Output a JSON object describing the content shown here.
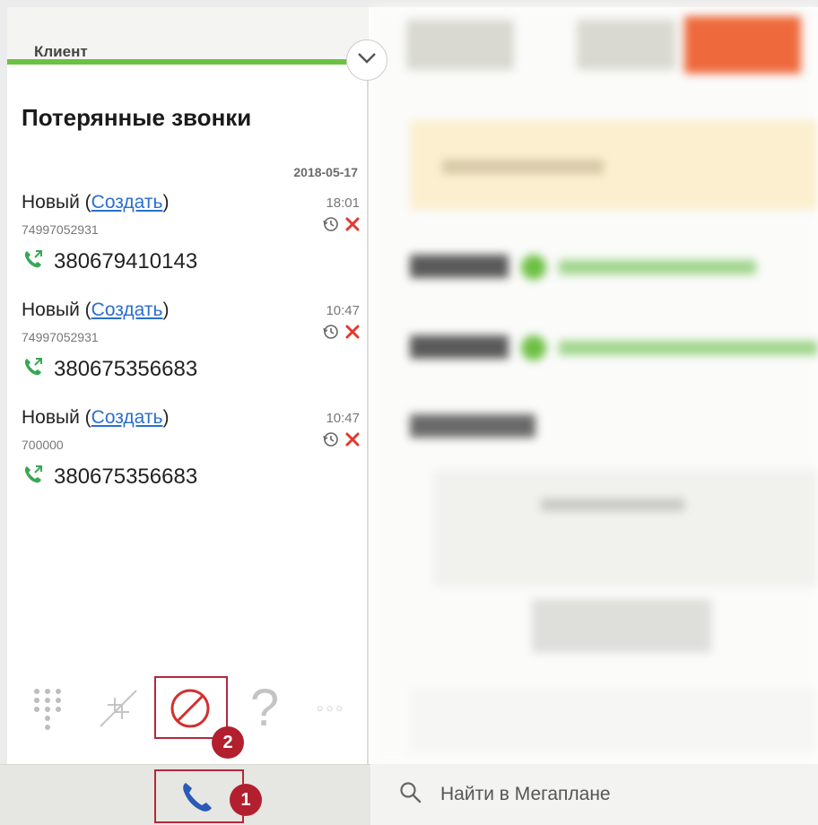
{
  "panel": {
    "client_label": "Клиент",
    "title": "Потерянные звонки",
    "date": "2018-05-17",
    "calls": [
      {
        "name": "Новый",
        "create_link": "Создать",
        "sub": "74997052931",
        "time": "18:01",
        "phone": "380679410143"
      },
      {
        "name": "Новый",
        "create_link": "Создать",
        "sub": "74997052931",
        "time": "10:47",
        "phone": "380675356683"
      },
      {
        "name": "Новый",
        "create_link": "Создать",
        "sub": "700000",
        "time": "10:47",
        "phone": "380675356683"
      }
    ]
  },
  "toolbar": {
    "help_glyph": "?",
    "more_glyph": "○○○",
    "badge_2": "2"
  },
  "bottom": {
    "badge_1": "1",
    "search_placeholder": "Найти в Мегаплане"
  },
  "colors": {
    "accent_green": "#6cc043",
    "link_blue": "#2b6ed1",
    "annotation_red": "#b21f2e",
    "orange_tab": "#ee6a3c"
  },
  "icons": [
    "chevron-down-icon",
    "history-icon",
    "delete-icon",
    "incoming-call-icon",
    "dialpad-icon",
    "transfer-icon",
    "block-icon",
    "help-icon",
    "more-icon",
    "phone-icon",
    "search-icon"
  ]
}
